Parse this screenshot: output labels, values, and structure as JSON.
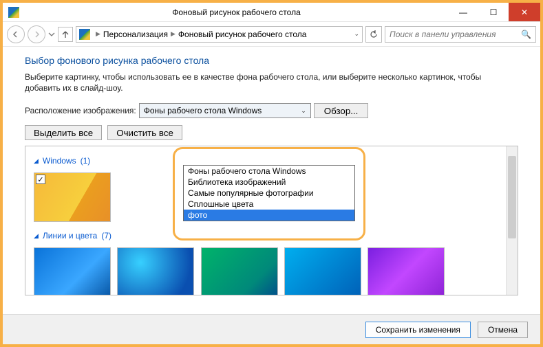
{
  "window": {
    "title": "Фоновый рисунок рабочего стола"
  },
  "nav": {
    "crumb1": "Персонализация",
    "crumb2": "Фоновый рисунок рабочего стола",
    "search_placeholder": "Поиск в панели управления"
  },
  "page": {
    "heading": "Выбор фонового рисунка рабочего стола",
    "description": "Выберите картинку, чтобы использовать ее в качестве фона рабочего стола, или выберите несколько картинок, чтобы добавить их в слайд-шоу."
  },
  "location": {
    "label": "Расположение изображения:",
    "selected": "Фоны рабочего стола Windows",
    "browse": "Обзор...",
    "options": [
      "Фоны рабочего стола Windows",
      "Библиотека изображений",
      "Самые популярные фотографии",
      "Сплошные цвета",
      "фото"
    ],
    "highlighted_index": 4
  },
  "selection": {
    "select_all": "Выделить все",
    "clear_all": "Очистить все"
  },
  "groups": {
    "g1": {
      "title": "Windows",
      "count": "(1)"
    },
    "g2": {
      "title": "Линии и цвета",
      "count": "(7)"
    }
  },
  "footer": {
    "save": "Сохранить изменения",
    "cancel": "Отмена"
  }
}
